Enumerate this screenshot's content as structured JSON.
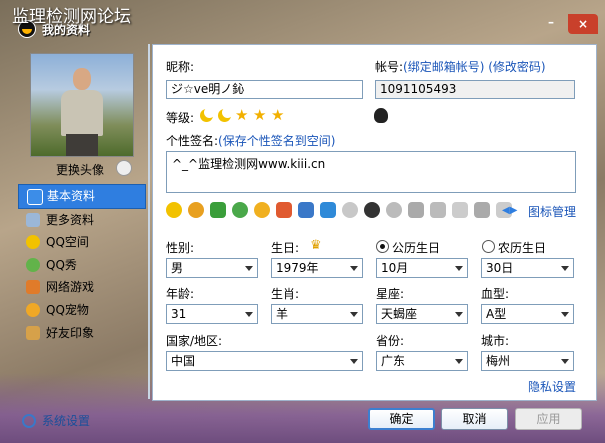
{
  "watermark": "监理检测网论坛",
  "window": {
    "title": "我的资料"
  },
  "left": {
    "change_avatar": "更换头像",
    "nav": [
      "基本资料",
      "更多资料",
      "QQ空间",
      "QQ秀",
      "网络游戏",
      "QQ宠物",
      "好友印象"
    ],
    "settings": "系统设置"
  },
  "form": {
    "nickname_label": "昵称:",
    "nickname_value": "ジ☆ve明ノ鈊",
    "account_label": "帐号:",
    "account_links": "(绑定邮箱帐号) (修改密码)",
    "account_value": "1091105493",
    "level_label": "等级:",
    "signature_label": "个性签名:",
    "signature_link": "(保存个性签名到空间)",
    "signature_value": "^_^监理检测网www.kiii.cn",
    "icon_manage": "图标管理",
    "gender_label": "性别:",
    "gender_value": "男",
    "birthday_label": "生日:",
    "birth_year": "1979年",
    "calendar_solar": "公历生日",
    "calendar_lunar": "农历生日",
    "birth_month": "10月",
    "birth_day": "30日",
    "age_label": "年龄:",
    "age_value": "31",
    "zodiac_label": "生肖:",
    "zodiac_value": "羊",
    "constellation_label": "星座:",
    "constellation_value": "天蝎座",
    "blood_label": "血型:",
    "blood_value": "A型",
    "country_label": "国家/地区:",
    "country_value": "中国",
    "province_label": "省份:",
    "province_value": "广东",
    "city_label": "城市:",
    "city_value": "梅州",
    "privacy": "隐私设置"
  },
  "buttons": {
    "ok": "确定",
    "cancel": "取消",
    "apply": "应用"
  },
  "colors": {
    "accent": "#2f7ee0",
    "link": "#1a55b8"
  }
}
